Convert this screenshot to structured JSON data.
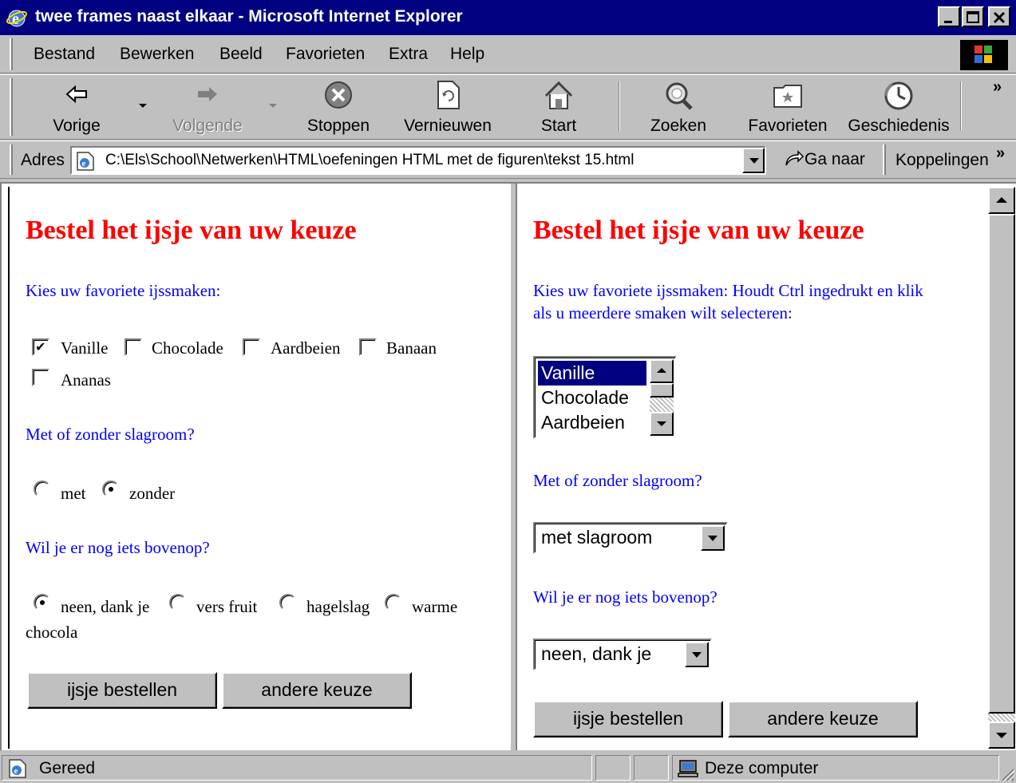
{
  "window": {
    "title": "twee frames naast elkaar - Microsoft Internet Explorer",
    "minimize_icon": "minimize-icon",
    "maximize_icon": "maximize-icon",
    "close_icon": "close-icon"
  },
  "menu": {
    "items": [
      "Bestand",
      "Bewerken",
      "Beeld",
      "Favorieten",
      "Extra",
      "Help"
    ]
  },
  "toolbar": {
    "back": "Vorige",
    "forward": "Volgende",
    "stop": "Stoppen",
    "refresh": "Vernieuwen",
    "home": "Start",
    "search": "Zoeken",
    "favorites": "Favorieten",
    "history": "Geschiedenis",
    "more": "»"
  },
  "address": {
    "label": "Adres",
    "url": "C:\\Els\\School\\Netwerken\\HTML\\oefeningen HTML met de figuren\\tekst 15.html",
    "go": "Ga naar",
    "links": "Koppelingen",
    "more": "»"
  },
  "left_frame": {
    "heading": "Bestel het ijsje van uw keuze",
    "flavors_question": "Kies uw favoriete ijssmaken:",
    "flavors": [
      {
        "label": "Vanille",
        "checked": true
      },
      {
        "label": "Chocolade",
        "checked": false
      },
      {
        "label": "Aardbeien",
        "checked": false
      },
      {
        "label": "Banaan",
        "checked": false
      },
      {
        "label": "Ananas",
        "checked": false
      }
    ],
    "cream_question": "Met of zonder slagroom?",
    "cream_options": [
      {
        "label": "met",
        "selected": false
      },
      {
        "label": "zonder",
        "selected": true
      }
    ],
    "topping_question": "Wil je er nog iets bovenop?",
    "topping_options": [
      {
        "label": "neen, dank je",
        "selected": true
      },
      {
        "label": "vers fruit",
        "selected": false
      },
      {
        "label": "hagelslag",
        "selected": false
      },
      {
        "label": "warme",
        "selected": false
      }
    ],
    "topping_wrap": "chocola",
    "order_button": "ijsje bestellen",
    "reset_button": "andere keuze"
  },
  "right_frame": {
    "heading": "Bestel het ijsje van uw keuze",
    "flavors_question_line1": "Kies uw favoriete ijssmaken: Houdt Ctrl ingedrukt en klik",
    "flavors_question_line2": "als u meerdere smaken wilt selecteren:",
    "flavor_list": [
      {
        "label": "Vanille",
        "selected": true
      },
      {
        "label": "Chocolade",
        "selected": false
      },
      {
        "label": "Aardbeien",
        "selected": false
      }
    ],
    "cream_question": "Met of zonder slagroom?",
    "cream_select": "met slagroom",
    "topping_question": "Wil je er nog iets bovenop?",
    "topping_select": "neen, dank je",
    "order_button": "ijsje bestellen",
    "reset_button": "andere keuze"
  },
  "status": {
    "text": "Gereed",
    "zone": "Deze computer"
  },
  "colors": {
    "title_bar": "#000080",
    "heading": "#ff0000",
    "question": "#0000ff",
    "chrome": "#c0c0c0",
    "selection": "#000080"
  }
}
